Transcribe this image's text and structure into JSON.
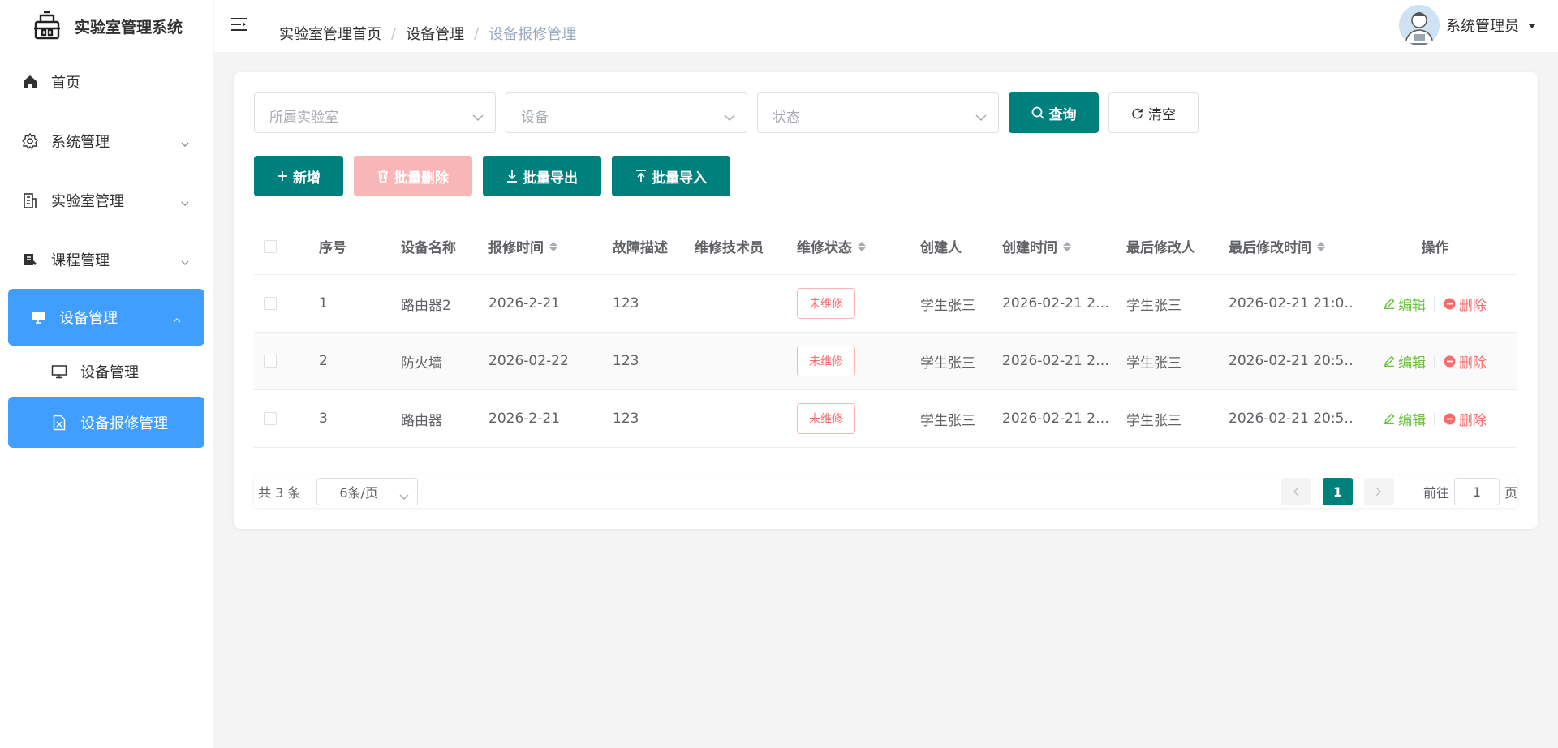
{
  "app": {
    "title": "实验室管理系统"
  },
  "sidebar": {
    "items": [
      {
        "label": "首页",
        "icon": "home-icon"
      },
      {
        "label": "系统管理",
        "icon": "gear-icon"
      },
      {
        "label": "实验室管理",
        "icon": "building-icon"
      },
      {
        "label": "课程管理",
        "icon": "book-icon"
      },
      {
        "label": "设备管理",
        "icon": "monitor-icon"
      }
    ],
    "subitems": [
      {
        "label": "设备管理",
        "icon": "monitor-outline-icon"
      },
      {
        "label": "设备报修管理",
        "icon": "document-x-icon"
      }
    ]
  },
  "header": {
    "breadcrumb": [
      "实验室管理首页",
      "设备管理",
      "设备报修管理"
    ],
    "user_name": "系统管理员"
  },
  "filters": {
    "lab_placeholder": "所属实验室",
    "device_placeholder": "设备",
    "status_placeholder": "状态",
    "query_label": "查询",
    "clear_label": "清空"
  },
  "toolbar": {
    "add_label": "新增",
    "batch_delete_label": "批量删除",
    "batch_export_label": "批量导出",
    "batch_import_label": "批量导入"
  },
  "table": {
    "columns": [
      "序号",
      "设备名称",
      "报修时间",
      "故障描述",
      "维修技术员",
      "维修状态",
      "创建人",
      "创建时间",
      "最后修改人",
      "最后修改时间",
      "操作"
    ],
    "rows": [
      {
        "idx": "1",
        "name": "路由器2",
        "time": "2026-2-21",
        "desc": "123",
        "tech": "",
        "status": "未维修",
        "creator": "学生张三",
        "ctime": "2026-02-21 2…",
        "modifier": "学生张三",
        "mtime": "2026-02-21 21:0…"
      },
      {
        "idx": "2",
        "name": "防火墙",
        "time": "2026-02-22",
        "desc": "123",
        "tech": "",
        "status": "未维修",
        "creator": "学生张三",
        "ctime": "2026-02-21 2…",
        "modifier": "学生张三",
        "mtime": "2026-02-21 20:5…"
      },
      {
        "idx": "3",
        "name": "路由器",
        "time": "2026-2-21",
        "desc": "123",
        "tech": "",
        "status": "未维修",
        "creator": "学生张三",
        "ctime": "2026-02-21 2…",
        "modifier": "学生张三",
        "mtime": "2026-02-21 20:5…"
      }
    ],
    "edit_label": "编辑",
    "delete_label": "删除"
  },
  "pagination": {
    "total_text": "共 3 条",
    "page_size": "6条/页",
    "current_page": "1",
    "goto_prefix": "前往",
    "goto_value": "1",
    "goto_suffix": "页"
  },
  "colors": {
    "primary": "#00807d",
    "active": "#409eff",
    "danger": "#f56c6c",
    "success": "#67c23a"
  }
}
